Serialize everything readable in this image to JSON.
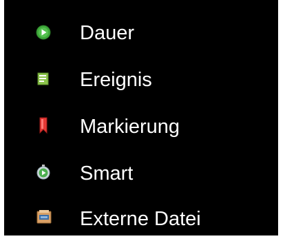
{
  "menu": {
    "items": [
      {
        "label": "Dauer",
        "icon": "play-circle-icon",
        "icon_color": "#3ea83a"
      },
      {
        "label": "Ereignis",
        "icon": "note-icon",
        "icon_color": "#7cb342"
      },
      {
        "label": "Markierung",
        "icon": "bookmark-icon",
        "icon_color": "#e53935"
      },
      {
        "label": "Smart",
        "icon": "smart-play-icon",
        "icon_color": "#4caf50"
      },
      {
        "label": "Externe Datei",
        "icon": "external-file-icon",
        "icon_color": "#d9a066"
      }
    ]
  }
}
